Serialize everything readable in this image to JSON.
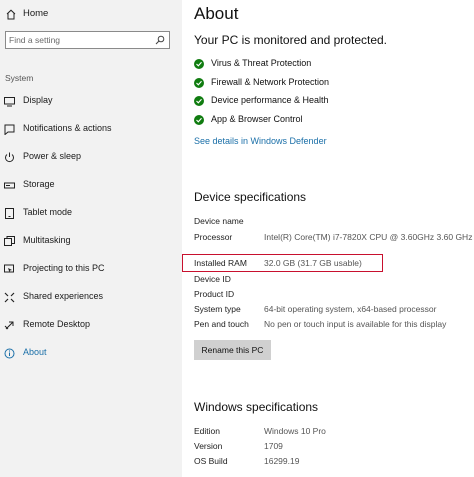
{
  "sidebar": {
    "home_label": "Home",
    "search_placeholder": "Find a setting",
    "section_header": "System",
    "items": [
      {
        "label": "Display",
        "icon": "display-icon"
      },
      {
        "label": "Notifications & actions",
        "icon": "notifications-icon"
      },
      {
        "label": "Power & sleep",
        "icon": "power-icon"
      },
      {
        "label": "Storage",
        "icon": "storage-icon"
      },
      {
        "label": "Tablet mode",
        "icon": "tablet-icon"
      },
      {
        "label": "Multitasking",
        "icon": "multitasking-icon"
      },
      {
        "label": "Projecting to this PC",
        "icon": "projecting-icon"
      },
      {
        "label": "Shared experiences",
        "icon": "shared-icon"
      },
      {
        "label": "Remote Desktop",
        "icon": "remote-desktop-icon"
      },
      {
        "label": "About",
        "icon": "info-icon",
        "active": true
      }
    ]
  },
  "main": {
    "title": "About",
    "protection": {
      "heading": "Your PC is monitored and protected.",
      "items": [
        "Virus & Threat Protection",
        "Firewall & Network Protection",
        "Device performance & Health",
        "App & Browser Control"
      ],
      "link": "See details in Windows Defender"
    },
    "device_specs": {
      "heading": "Device specifications",
      "rows": [
        {
          "key": "Device name",
          "value": ""
        },
        {
          "key": "Processor",
          "value": "Intel(R) Core(TM) i7-7820X CPU @ 3.60GHz   3.60 GHz"
        },
        {
          "key": "Installed RAM",
          "value": "32.0 GB (31.7 GB usable)"
        },
        {
          "key": "Device ID",
          "value": ""
        },
        {
          "key": "Product ID",
          "value": ""
        },
        {
          "key": "System type",
          "value": "64-bit operating system, x64-based processor"
        },
        {
          "key": "Pen and touch",
          "value": "No pen or touch input is available for this display"
        }
      ],
      "rename_button": "Rename this PC"
    },
    "windows_specs": {
      "heading": "Windows specifications",
      "rows": [
        {
          "key": "Edition",
          "value": "Windows 10 Pro"
        },
        {
          "key": "Version",
          "value": "1709"
        },
        {
          "key": "OS Build",
          "value": "16299.19"
        }
      ]
    }
  },
  "colors": {
    "accent": "#1a6fa8",
    "check_green": "#107c10",
    "highlight_red": "#c8102e",
    "sidebar_bg": "#f2f2f2"
  }
}
